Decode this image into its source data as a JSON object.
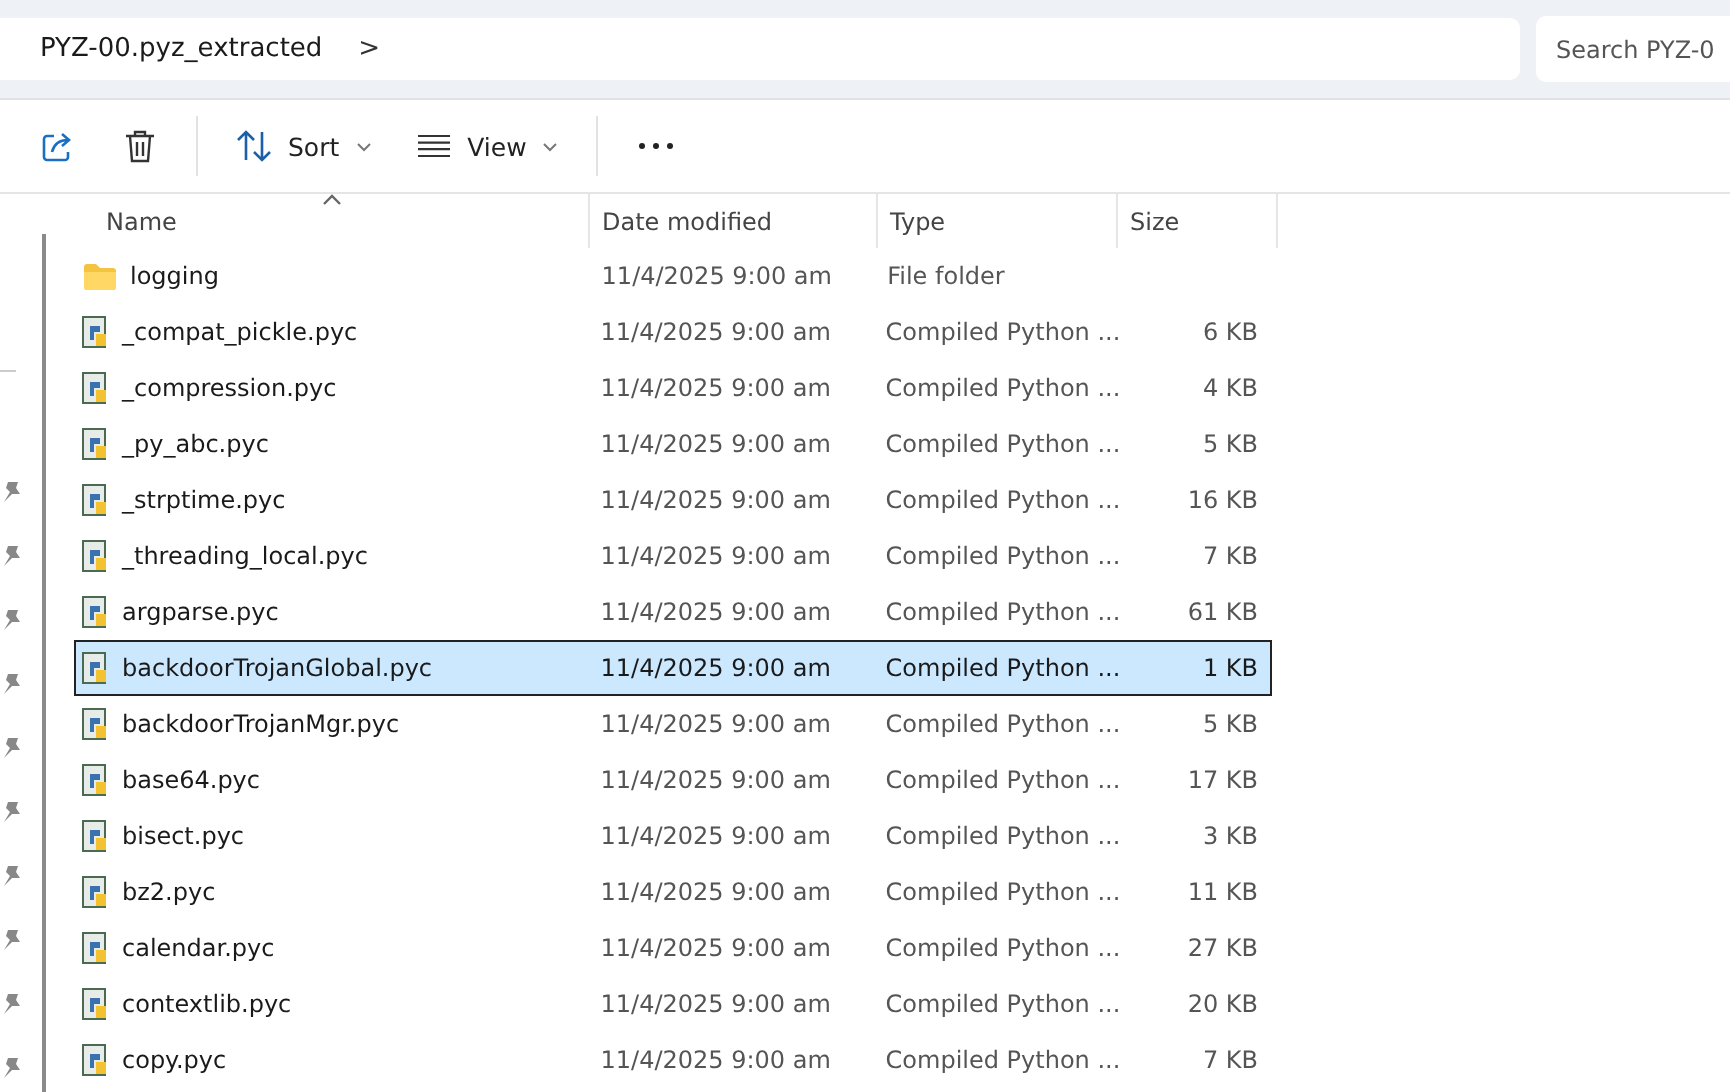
{
  "address_bar": {
    "path": "PYZ-00.pyz_extracted",
    "separator": ">"
  },
  "search": {
    "placeholder": "Search PYZ-0"
  },
  "toolbar": [
    {
      "kind": "share"
    },
    {
      "kind": "delete"
    },
    {
      "kind": "sort",
      "label": "Sort"
    },
    {
      "kind": "view",
      "label": "View"
    },
    {
      "kind": "more"
    }
  ],
  "table": {
    "columns": [
      {
        "label": "Name",
        "sorted": true
      },
      {
        "label": "Date modified",
        "sorted": false
      },
      {
        "label": "Type",
        "sorted": false
      },
      {
        "label": "Size",
        "sorted": false
      }
    ],
    "rows": [
      {
        "kind": "folder",
        "name": "logging",
        "date": "11/4/2025 9:00 am",
        "type": "File folder",
        "size": "",
        "selected": false
      },
      {
        "kind": "file",
        "name": "_compat_pickle.pyc",
        "date": "11/4/2025 9:00 am",
        "type": "Compiled Python ...",
        "size": "6 KB",
        "selected": false
      },
      {
        "kind": "file",
        "name": "_compression.pyc",
        "date": "11/4/2025 9:00 am",
        "type": "Compiled Python ...",
        "size": "4 KB",
        "selected": false
      },
      {
        "kind": "file",
        "name": "_py_abc.pyc",
        "date": "11/4/2025 9:00 am",
        "type": "Compiled Python ...",
        "size": "5 KB",
        "selected": false
      },
      {
        "kind": "file",
        "name": "_strptime.pyc",
        "date": "11/4/2025 9:00 am",
        "type": "Compiled Python ...",
        "size": "16 KB",
        "selected": false
      },
      {
        "kind": "file",
        "name": "_threading_local.pyc",
        "date": "11/4/2025 9:00 am",
        "type": "Compiled Python ...",
        "size": "7 KB",
        "selected": false
      },
      {
        "kind": "file",
        "name": "argparse.pyc",
        "date": "11/4/2025 9:00 am",
        "type": "Compiled Python ...",
        "size": "61 KB",
        "selected": false
      },
      {
        "kind": "file",
        "name": "backdoorTrojanGlobal.pyc",
        "date": "11/4/2025 9:00 am",
        "type": "Compiled Python ...",
        "size": "1 KB",
        "selected": true
      },
      {
        "kind": "file",
        "name": "backdoorTrojanMgr.pyc",
        "date": "11/4/2025 9:00 am",
        "type": "Compiled Python ...",
        "size": "5 KB",
        "selected": false
      },
      {
        "kind": "file",
        "name": "base64.pyc",
        "date": "11/4/2025 9:00 am",
        "type": "Compiled Python ...",
        "size": "17 KB",
        "selected": false
      },
      {
        "kind": "file",
        "name": "bisect.pyc",
        "date": "11/4/2025 9:00 am",
        "type": "Compiled Python ...",
        "size": "3 KB",
        "selected": false
      },
      {
        "kind": "file",
        "name": "bz2.pyc",
        "date": "11/4/2025 9:00 am",
        "type": "Compiled Python ...",
        "size": "11 KB",
        "selected": false
      },
      {
        "kind": "file",
        "name": "calendar.pyc",
        "date": "11/4/2025 9:00 am",
        "type": "Compiled Python ...",
        "size": "27 KB",
        "selected": false
      },
      {
        "kind": "file",
        "name": "contextlib.pyc",
        "date": "11/4/2025 9:00 am",
        "type": "Compiled Python ...",
        "size": "20 KB",
        "selected": false
      },
      {
        "kind": "file",
        "name": "copy.pyc",
        "date": "11/4/2025 9:00 am",
        "type": "Compiled Python ...",
        "size": "7 KB",
        "selected": false
      }
    ]
  }
}
